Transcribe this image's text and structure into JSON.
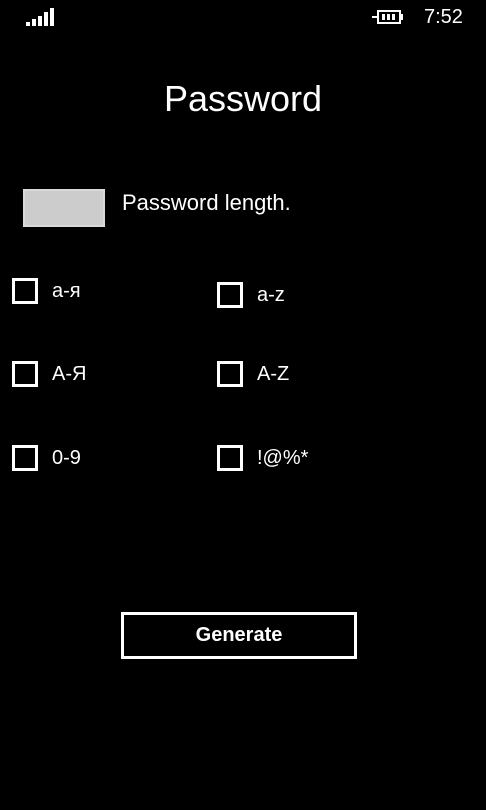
{
  "status_bar": {
    "time": "7:52",
    "signal_icon": "signal-strength-icon",
    "battery_icon": "battery-charging-icon"
  },
  "page": {
    "title": "Password"
  },
  "length": {
    "value": "",
    "label": "Password length."
  },
  "options": [
    {
      "label": "а-я",
      "checked": false
    },
    {
      "label": "a-z",
      "checked": false
    },
    {
      "label": "А-Я",
      "checked": false
    },
    {
      "label": "A-Z",
      "checked": false
    },
    {
      "label": "0-9",
      "checked": false
    },
    {
      "label": "!@%*",
      "checked": false
    }
  ],
  "actions": {
    "generate_label": "Generate"
  },
  "colors": {
    "background": "#000000",
    "foreground": "#ffffff",
    "input_fill": "#cccccc"
  }
}
